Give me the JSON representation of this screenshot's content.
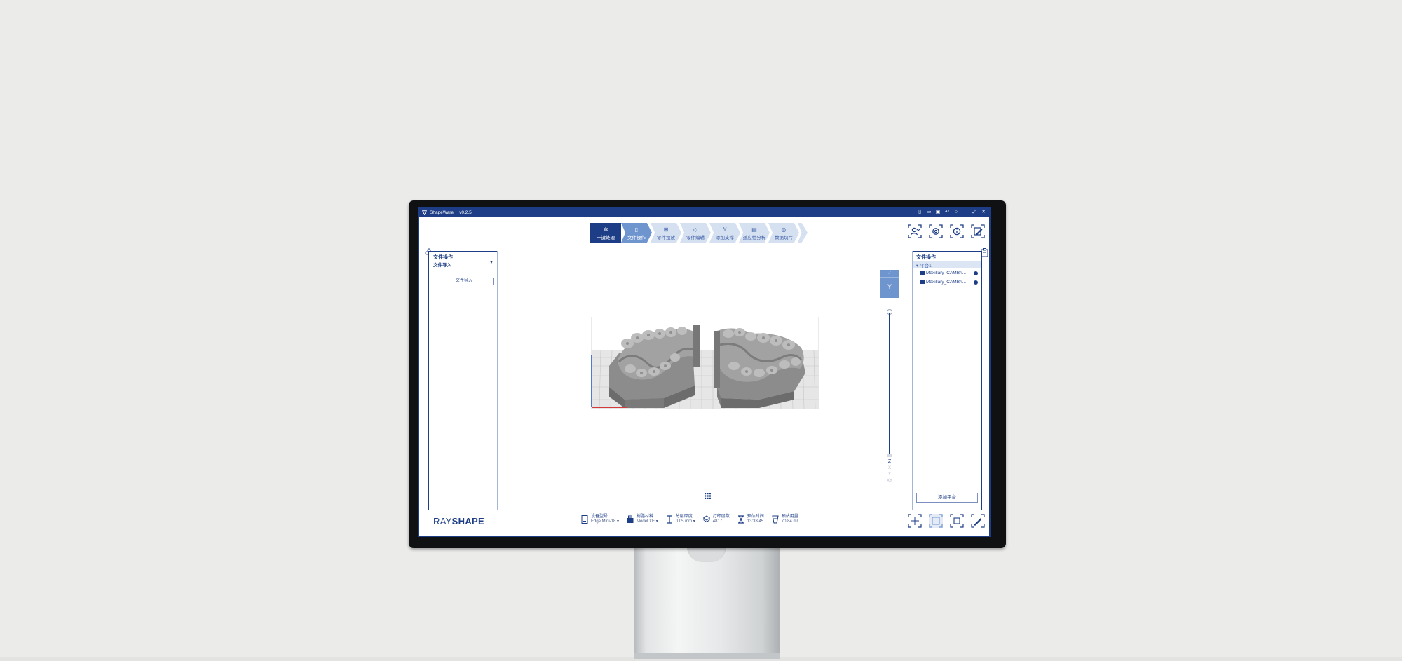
{
  "window": {
    "app_name": "ShapeWare",
    "version": "v0.2.5"
  },
  "toolbar": {
    "onekey_label": "一键处理",
    "steps": [
      {
        "label": "文件操作",
        "icon": "file-icon"
      },
      {
        "label": "零件摆放",
        "icon": "grid-icon"
      },
      {
        "label": "零件编辑",
        "icon": "edit-part-icon"
      },
      {
        "label": "添加支撑",
        "icon": "support-icon"
      },
      {
        "label": "适应性分析",
        "icon": "analysis-icon"
      },
      {
        "label": "数据切片",
        "icon": "slice-icon"
      }
    ],
    "active_step": 0
  },
  "left_panel": {
    "header": "文件操作",
    "section": "文件导入",
    "import_button": "文件导入"
  },
  "viewport": {
    "view_cube_face": "Y",
    "axis_labels": [
      "Z",
      "X",
      "Y",
      "XY"
    ]
  },
  "right_panel": {
    "header": "文件操作",
    "platform": "平台1",
    "models": [
      "Maxillary_CAMBri...",
      "Maxillary_CAMBri..."
    ],
    "add_platform_button": "添加平台"
  },
  "brand": {
    "part1": "RAY",
    "part2": "SHAPE"
  },
  "status": [
    {
      "label": "设备型号",
      "value": "Edge Mini-18 ▾",
      "icon": "device-icon"
    },
    {
      "label": "树脂材料",
      "value": "Model XE ▾",
      "icon": "resin-icon"
    },
    {
      "label": "分层厚度",
      "value": "0.05 mm ▾",
      "icon": "layer-thickness-icon"
    },
    {
      "label": "打印层数",
      "value": "4817",
      "icon": "layers-icon"
    },
    {
      "label": "预估时间",
      "value": "13:33:45",
      "icon": "hourglass-icon"
    },
    {
      "label": "预估用量",
      "value": "70.84 ml",
      "icon": "resin-volume-icon"
    }
  ],
  "colors": {
    "primary": "#1d3e86",
    "step_active": "#6f95cf",
    "step_inactive": "#d5e0f0"
  }
}
